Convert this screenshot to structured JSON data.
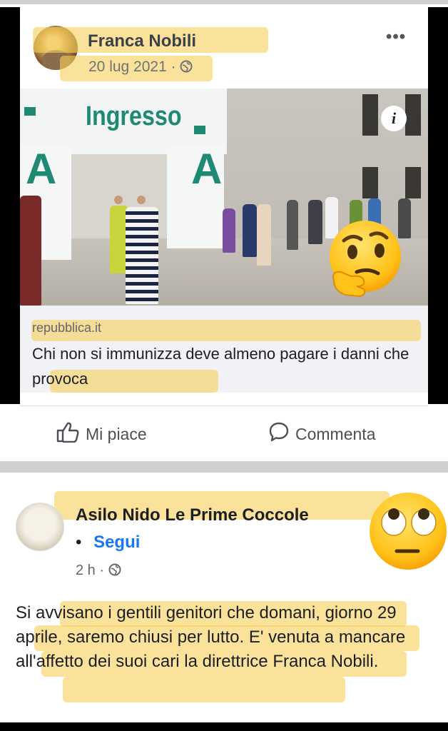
{
  "post1": {
    "author": "Franca Nobili",
    "date": "20 lug 2021",
    "separator": "·",
    "menu": "•••",
    "photo": {
      "sign_text": "Ingresso",
      "letter": "A",
      "info_symbol": "i"
    },
    "link": {
      "source": "repubblica.it",
      "headline": "Chi non si immunizza deve almeno pagare i danni che provoca"
    },
    "actions": {
      "like": "Mi piace",
      "comment": "Commenta"
    },
    "emoji": "thinking-face"
  },
  "post2": {
    "author": "Asilo Nido Le Prime Coccole",
    "bullet": "•",
    "follow": "Segui",
    "time": "2 h",
    "separator": "·",
    "body": "Si avvisano i gentili genitori che domani, giorno 29 aprile, saremo chiusi per lutto. E' venuta a mancare all'affetto dei suoi cari la direttrice Franca Nobili.",
    "emoji": "face-with-rolling-eyes"
  },
  "colors": {
    "highlight": "#f7d05c",
    "link_blue": "#1877f2",
    "sign_green": "#1f8a74"
  }
}
